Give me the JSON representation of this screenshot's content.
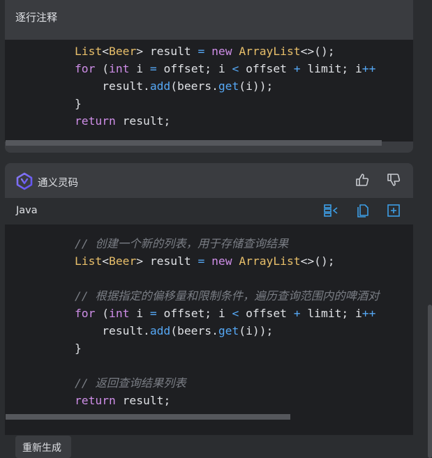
{
  "top_card": {
    "header_title": "逐行注释",
    "code_lines": [
      {
        "tokens": [
          [
            "ty",
            "List"
          ],
          [
            "br",
            "<"
          ],
          [
            "ty",
            "Beer"
          ],
          [
            "br",
            "> "
          ],
          [
            "id",
            "result "
          ],
          [
            "op",
            "="
          ],
          [
            "id",
            " "
          ],
          [
            "kw",
            "new"
          ],
          [
            "id",
            " "
          ],
          [
            "ty",
            "ArrayList"
          ],
          [
            "br",
            "<>();"
          ]
        ]
      },
      {
        "tokens": [
          [
            "kw",
            "for"
          ],
          [
            "id",
            " ("
          ],
          [
            "kw",
            "int"
          ],
          [
            "id",
            " i "
          ],
          [
            "op",
            "="
          ],
          [
            "id",
            " offset; i "
          ],
          [
            "op",
            "<"
          ],
          [
            "id",
            " offset "
          ],
          [
            "op",
            "+"
          ],
          [
            "id",
            " limit; i"
          ],
          [
            "op",
            "++"
          ]
        ]
      },
      {
        "tokens": [
          [
            "id",
            "    result."
          ],
          [
            "fn",
            "add"
          ],
          [
            "id",
            "(beers."
          ],
          [
            "fn",
            "get"
          ],
          [
            "id",
            "(i));"
          ]
        ]
      },
      {
        "tokens": [
          [
            "id",
            "}"
          ]
        ]
      },
      {
        "tokens": [
          [
            "kw",
            "return"
          ],
          [
            "id",
            " result;"
          ]
        ]
      }
    ]
  },
  "assistant": {
    "name": "通义灵码",
    "thumbs_up_icon": "thumbs-up-icon",
    "thumbs_down_icon": "thumbs-down-icon"
  },
  "code_panel": {
    "language": "Java",
    "tools": [
      "insert-diff-icon",
      "copy-icon",
      "insert-file-icon"
    ],
    "code_lines": [
      {
        "tokens": [
          [
            "cm",
            "// 创建一个新的列表，用于存储查询结果"
          ]
        ]
      },
      {
        "tokens": [
          [
            "ty",
            "List"
          ],
          [
            "br",
            "<"
          ],
          [
            "ty",
            "Beer"
          ],
          [
            "br",
            "> "
          ],
          [
            "id",
            "result "
          ],
          [
            "op",
            "="
          ],
          [
            "id",
            " "
          ],
          [
            "kw",
            "new"
          ],
          [
            "id",
            " "
          ],
          [
            "ty",
            "ArrayList"
          ],
          [
            "br",
            "<>();"
          ]
        ]
      },
      {
        "tokens": []
      },
      {
        "tokens": [
          [
            "cm",
            "// 根据指定的偏移量和限制条件，遍历查询范围内的啤酒对"
          ]
        ]
      },
      {
        "tokens": [
          [
            "kw",
            "for"
          ],
          [
            "id",
            " ("
          ],
          [
            "kw",
            "int"
          ],
          [
            "id",
            " i "
          ],
          [
            "op",
            "="
          ],
          [
            "id",
            " offset; i "
          ],
          [
            "op",
            "<"
          ],
          [
            "id",
            " offset "
          ],
          [
            "op",
            "+"
          ],
          [
            "id",
            " limit; i"
          ],
          [
            "op",
            "++"
          ]
        ]
      },
      {
        "tokens": [
          [
            "id",
            "    result."
          ],
          [
            "fn",
            "add"
          ],
          [
            "id",
            "(beers."
          ],
          [
            "fn",
            "get"
          ],
          [
            "id",
            "(i));"
          ]
        ]
      },
      {
        "tokens": [
          [
            "id",
            "}"
          ]
        ]
      },
      {
        "tokens": []
      },
      {
        "tokens": [
          [
            "cm",
            "// 返回查询结果列表"
          ]
        ]
      },
      {
        "tokens": [
          [
            "kw",
            "return"
          ],
          [
            "id",
            " result;"
          ]
        ]
      }
    ]
  },
  "regenerate_label": "重新生成",
  "colors": {
    "background": "#2b2d30",
    "card": "#3a3c40",
    "code_bg": "#1e1f22",
    "keyword": "#cf8ee8",
    "type": "#e8bf6a",
    "function": "#56a8f5",
    "comment": "#7a7e85",
    "tool_icon": "#3d9ee6"
  }
}
